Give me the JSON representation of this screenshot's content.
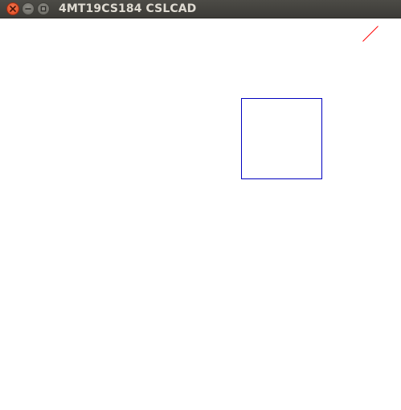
{
  "window": {
    "title": "4MT19CS184 CSLCAD"
  },
  "icons": {
    "close": "close-icon",
    "minimize": "minimize-icon",
    "maximize": "maximize-icon"
  },
  "colors": {
    "line": "#ff0000",
    "rectangle": "#0000c0",
    "titlebar": "#3c3b37",
    "close_button": "#e75a31"
  }
}
